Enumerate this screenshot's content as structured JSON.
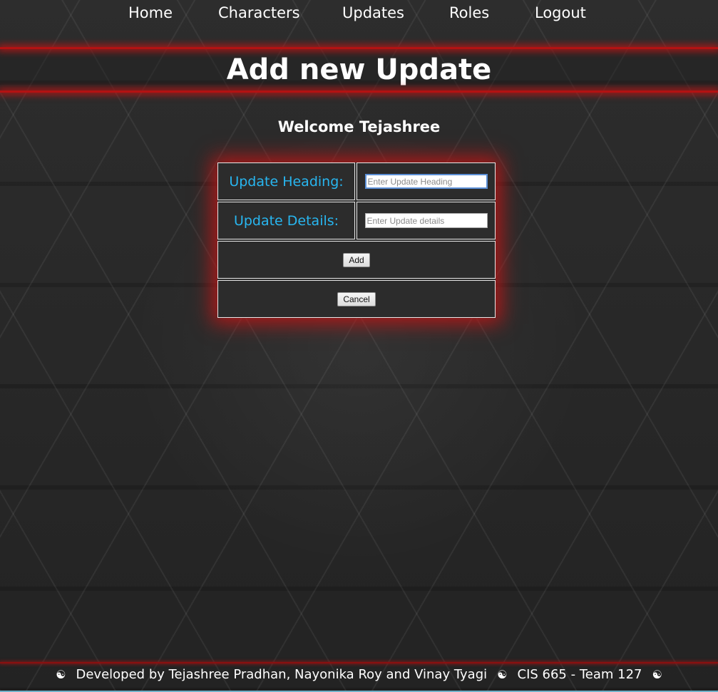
{
  "nav": {
    "items": [
      {
        "label": "Home"
      },
      {
        "label": "Characters"
      },
      {
        "label": "Updates"
      },
      {
        "label": "Roles"
      },
      {
        "label": "Logout"
      }
    ]
  },
  "header": {
    "title": "Add new Update"
  },
  "welcome": "Welcome Tejashree",
  "form": {
    "heading_label": "Update Heading:",
    "heading_placeholder": "Enter Update Heading",
    "heading_value": "",
    "details_label": "Update Details:",
    "details_placeholder": "Enter Update details",
    "details_value": "",
    "add_label": "Add",
    "cancel_label": "Cancel"
  },
  "footer": {
    "symbol": "☯",
    "credits": "Developed by Tejashree Pradhan, Nayonika Roy and Vinay Tyagi",
    "team": "CIS 665 - Team 127"
  },
  "colors": {
    "accent_red": "#b31212",
    "label_blue": "#28b6f0",
    "background": "#2a2a2a"
  }
}
